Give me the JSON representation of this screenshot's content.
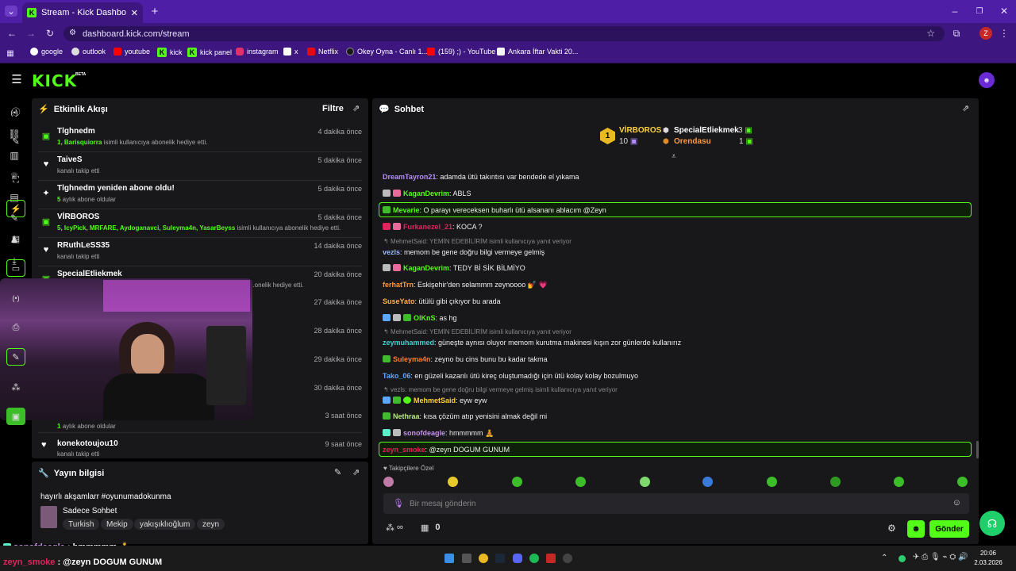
{
  "browser": {
    "tab_title": "Stream - Kick Dashboard",
    "url": "dashboard.kick.com/stream",
    "profile_letter": "Z",
    "bookmarks": [
      "google",
      "outlook",
      "youtube",
      "kick",
      "kick panel",
      "instagram",
      "x",
      "Netflix",
      "Okey Oyna - Canlı 1...",
      "(159) ;) - YouTube",
      "Ankara İftar Vakti 20..."
    ]
  },
  "brand": {
    "logo": "KICK",
    "beta": "BETA",
    "accent": "#53fc18"
  },
  "activity": {
    "title": "Etkinlik Akışı",
    "filter": "Filtre",
    "items": [
      {
        "name": "Tlghnedm",
        "sub_pre": "1, ",
        "sub_users": "Barisquiorra",
        "sub_post": " isimli kullanıcıya abonelik hediye etti.",
        "time": "4 dakika önce",
        "icon": "gift-icon"
      },
      {
        "name": "TaiveS",
        "sub_pre": "kanalı takip etti",
        "sub_users": "",
        "sub_post": "",
        "time": "5 dakika önce",
        "icon": "heart-icon"
      },
      {
        "name": "Tlghnedm yeniden abone oldu!",
        "sub_pre": "",
        "sub_users": "5",
        "sub_post": " aylık abone oldular",
        "time": "5 dakika önce",
        "icon": "star-icon"
      },
      {
        "name": "VİRBOROS",
        "sub_pre": "5, ",
        "sub_users": "IcyPick, MRFARE, Aydoganavci, Suleyma4n, YasarBeyss",
        "sub_post": " isimli kullanıcıya abonelik hediye etti.",
        "time": "5 dakika önce",
        "icon": "gift-icon"
      },
      {
        "name": "RRuthLeSS35",
        "sub_pre": "kanalı takip etti",
        "sub_users": "",
        "sub_post": "",
        "time": "14 dakika önce",
        "icon": "heart-icon"
      },
      {
        "name": "SpecialEtliekmek",
        "sub_pre": "",
        "sub_users": "",
        "sub_post": "...onelik hediye etti.",
        "time": "20 dakika önce",
        "icon": "gift-icon"
      }
    ],
    "hidden_times": [
      "27 dakika önce",
      "28 dakika önce",
      "29 dakika önce",
      "30 dakika önce",
      "3 saat önce"
    ],
    "partial_sub": "aylık abone oldular",
    "partial_sub_count": "1",
    "last_name": "konekotoujou10",
    "last_sub": "kanalı takip etti",
    "last_time": "9 saat önce"
  },
  "stream_info": {
    "title": "Yayın bilgisi",
    "stream_title": "hayırlı akşamlarr #oyunumadokunma",
    "category": "Sadece Sohbet",
    "tags": [
      "Turkish",
      "Mekip",
      "yakışıklıoğlum",
      "zeyn"
    ]
  },
  "chat": {
    "title": "Sohbet",
    "leaderboard": {
      "first_rank": "1",
      "first_name": "VİRBOROS",
      "first_count": "10",
      "second_name": "SpecialEtliekmek",
      "second_count": "3",
      "third_name": "Orendasu",
      "third_count": "1"
    },
    "messages": [
      {
        "user": "DreamTayron21",
        "color": "#b48cff",
        "text": ": adamda ütü takıntısı var bendede el yıkama"
      },
      {
        "user": "KaganDevrim",
        "color": "#53fc18",
        "text": ": ABLS"
      },
      {
        "user": "Mevarie",
        "color": "#53fc18",
        "text": ": O parayı vereceksen buharlı ütü alsananı ablacım @Zeyn",
        "highlight": true
      },
      {
        "user": "Furkanezel_21",
        "color": "#e0245e",
        "text": ": KOCA ?"
      },
      {
        "reply": "MehmetSaid: YEMİN EDEBİLİRİM isimli kullanıcıya yanıt veriyor",
        "user": "vezls",
        "color": "#9ab3ff",
        "text": ": memom be gene doğru bilgi vermeye gelmiş"
      },
      {
        "user": "KaganDevrim",
        "color": "#53fc18",
        "text": ": TEDY Bİ SİK BİLMİYO"
      },
      {
        "user": "ferhatTrn",
        "color": "#ff9a3c",
        "text": ": Eskişehir'den selammm zeynoooo 💅 💗"
      },
      {
        "user": "SuseYato",
        "color": "#ffb347",
        "text": ": ütülü gibi çıkıyor bu arada"
      },
      {
        "user": "OlKnS",
        "color": "#53fc18",
        "text": ": as hg"
      },
      {
        "reply": "MehmetSaid: YEMİN EDEBİLİRİM isimli kullanıcıya yanıt veriyor",
        "user": "zeymuhammed",
        "color": "#3ecfcf",
        "text": ": güneşte aynısı oluyor memom kurutma makinesi kışın zor günlerde kullanırız"
      },
      {
        "user": "Suleyma4n",
        "color": "#ff7b2e",
        "text": ": zeyno bu cins bunu bu kadar takma"
      },
      {
        "user": "Tako_06",
        "color": "#5aa8ff",
        "text": ": en güzeli kazanlı ütü kireç oluştumadığı için ütü kolay kolay bozulmuyo"
      },
      {
        "reply": "vezls: memom be gene doğru bilgi vermeye gelmiş isimli kullanıcıya yanıt veriyor",
        "user": "MehmetSaid",
        "color": "#ffcf3a",
        "text": ": eyw eyw"
      },
      {
        "user": "Nethraa",
        "color": "#b8e986",
        "text": ": kısa çözüm atıp yenisini almak değil mi"
      },
      {
        "user": "sonofdeagle",
        "color": "#c792ea",
        "text": ": hmmmmm 🧘"
      },
      {
        "user": "zeyn_smoke",
        "color": "#e0245e",
        "text": ": @zeyn DOGUM GUNUM",
        "highlight": true
      }
    ],
    "emote_section": "Takipçilere Özel",
    "input_placeholder": "Bir mesaj gönderin",
    "infinity": "∞",
    "count": "0",
    "send": "Gönder"
  },
  "overlay": {
    "line1_user": "sonofdeagle",
    "line1_text": " : hmmmmm 🧘",
    "line2_user": "zeyn_smoke",
    "line2_text": " : @zeyn DOGUM GUNUM"
  },
  "taskbar": {
    "time": "20:06",
    "date": "2.03.2026"
  }
}
